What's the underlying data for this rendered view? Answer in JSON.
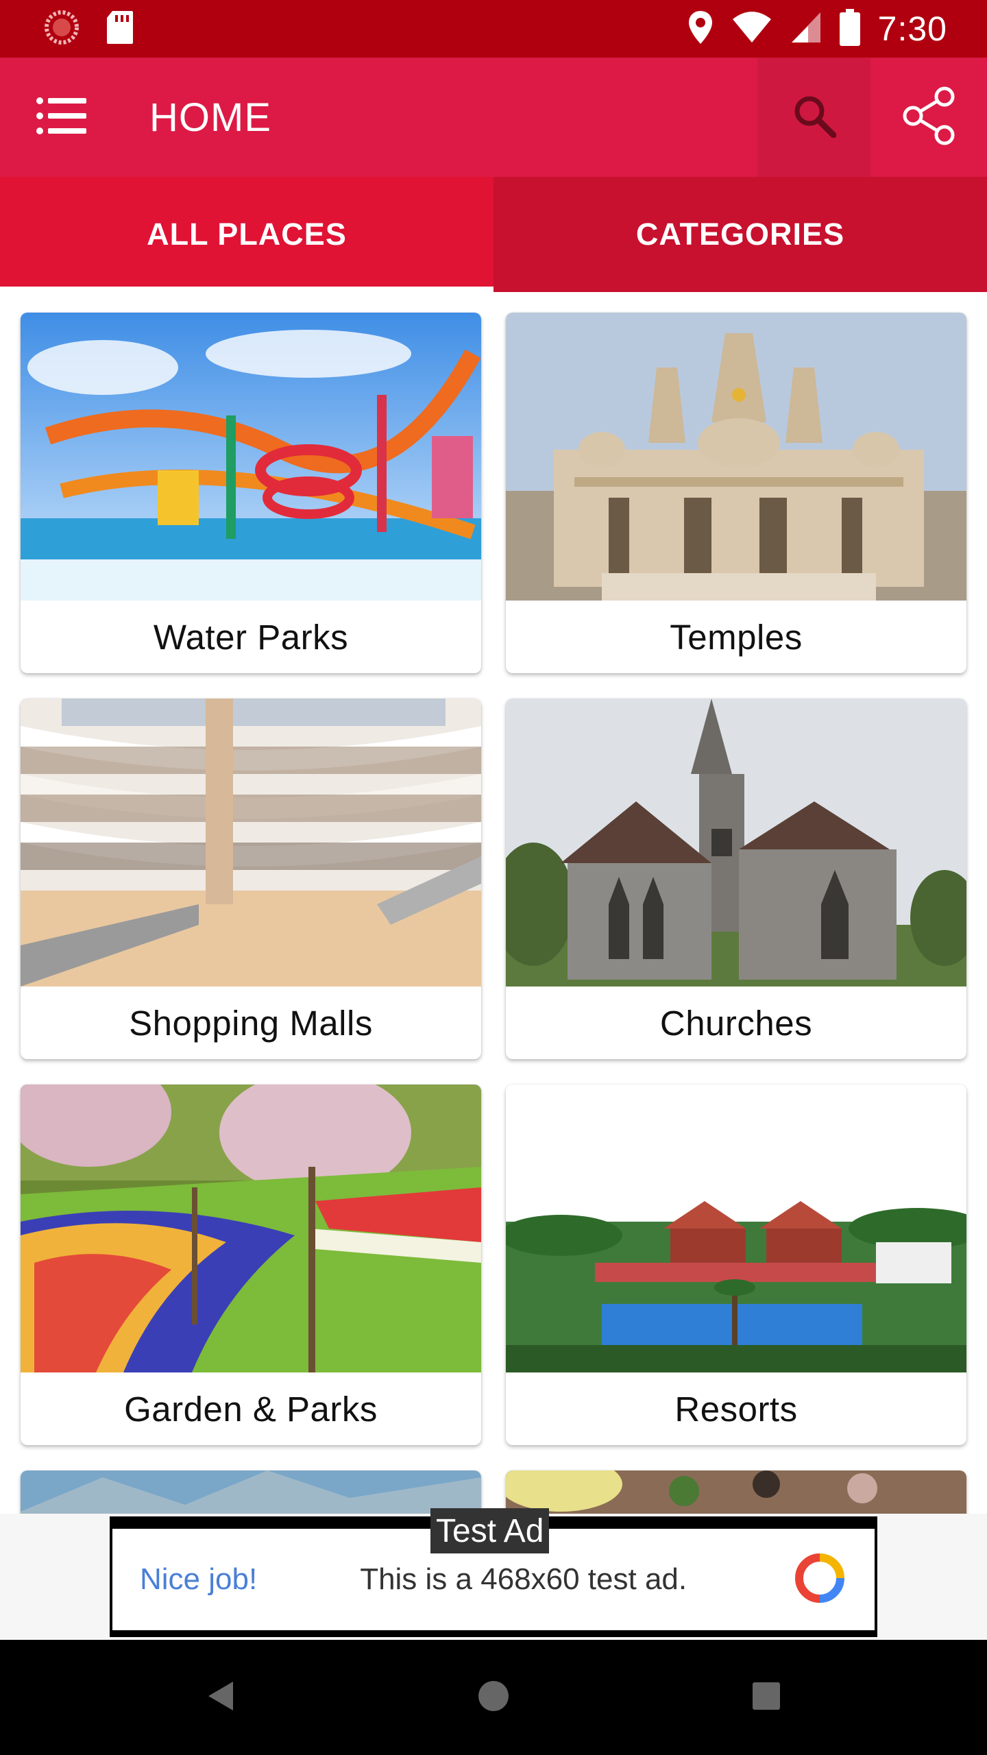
{
  "status_bar": {
    "time": "7:30",
    "icons": [
      "spinner-icon",
      "sd-card-icon",
      "location-icon",
      "wifi-icon",
      "signal-icon",
      "battery-icon"
    ]
  },
  "app_bar": {
    "title": "HOME",
    "icons": [
      "menu-list-icon",
      "search-icon",
      "share-icon"
    ],
    "color": "#dc1a45"
  },
  "tabs": [
    {
      "label": "ALL PLACES",
      "selected": true
    },
    {
      "label": "CATEGORIES",
      "selected": false
    }
  ],
  "places": [
    {
      "label": "Water Parks"
    },
    {
      "label": "Temples"
    },
    {
      "label": "Shopping Malls"
    },
    {
      "label": "Churches"
    },
    {
      "label": "Garden & Parks"
    },
    {
      "label": "Resorts"
    }
  ],
  "ad": {
    "badge": "Test Ad",
    "headline": "Nice job!",
    "body": "This is a 468x60 test ad."
  },
  "nav": {
    "icons": [
      "back-icon",
      "home-icon",
      "recents-icon"
    ]
  },
  "colors": {
    "status_bar": "#b0000f",
    "tab_selected": "#e01335",
    "tab_unselected": "#c8102f"
  }
}
